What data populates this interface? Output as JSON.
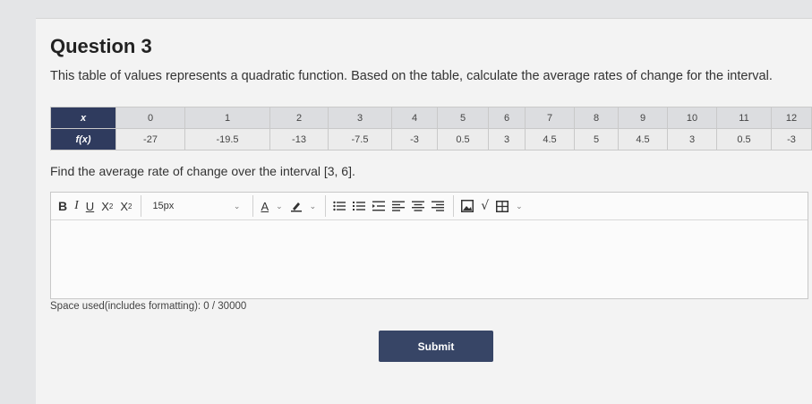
{
  "question": {
    "title": "Question 3",
    "prompt": "This table of values represents a quadratic function. Based on the table, calculate the average rates of change for the interval."
  },
  "table": {
    "x_label": "x",
    "fx_label": "f(x)",
    "x_values": [
      "0",
      "1",
      "2",
      "3",
      "4",
      "5",
      "6",
      "7",
      "8",
      "9",
      "10",
      "11",
      "12"
    ],
    "fx_values": [
      "-27",
      "-19.5",
      "-13",
      "-7.5",
      "-3",
      "0.5",
      "3",
      "4.5",
      "5",
      "4.5",
      "3",
      "0.5",
      "-3"
    ]
  },
  "subquestion": "Find the average rate of change over the interval [3, 6].",
  "editor": {
    "font_size": "15px",
    "value": ""
  },
  "usage_text": "Space used(includes formatting): 0 / 30000",
  "submit_label": "Submit",
  "colors": {
    "header_cell": "#2f3b5e",
    "submit_button": "#374566"
  }
}
